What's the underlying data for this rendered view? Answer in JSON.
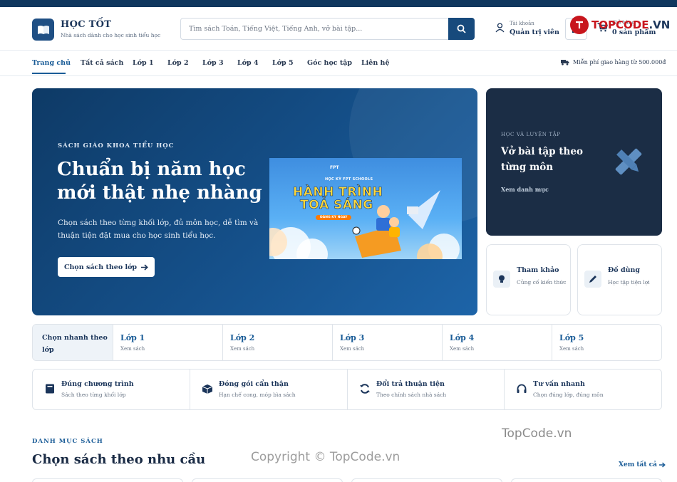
{
  "brand": {
    "name": "HỌC TỐT",
    "tagline": "Nhà sách dành cho học sinh tiểu học"
  },
  "search": {
    "placeholder": "Tìm sách Toán, Tiếng Việt, Tiếng Anh, vở bài tập..."
  },
  "account": {
    "label": "Tài khoản",
    "value": "Quản trị viên"
  },
  "cart": {
    "label": "Giỏ hàng",
    "value": "0 sản phẩm"
  },
  "watermark_logo": {
    "brand": "TOPCODE",
    "suffix": ".VN"
  },
  "nav": {
    "items": [
      {
        "label": "Trang chủ",
        "active": true
      },
      {
        "label": "Tất cả sách"
      },
      {
        "label": "Lớp 1"
      },
      {
        "label": "Lớp 2"
      },
      {
        "label": "Lớp 3"
      },
      {
        "label": "Lớp 4"
      },
      {
        "label": "Lớp 5"
      },
      {
        "label": "Góc học tập"
      },
      {
        "label": "Liên hệ"
      }
    ],
    "shipping": "Miễn phí giao hàng từ 500.000đ"
  },
  "hero": {
    "eyebrow": "SÁCH GIÁO KHOA TIỂU HỌC",
    "title": "Chuẩn bị năm học mới thật nhẹ nhàng",
    "description": "Chọn sách theo từng khối lớp, đủ môn học, dễ tìm và thuận tiện đặt mua cho học sinh tiểu học.",
    "button": "Chọn sách theo lớp",
    "banner": {
      "org": "FPT",
      "school": "HỌC KỲ FPT SCHOOLS",
      "line1": "HÀNH TRÌNH",
      "line2": "TOẢ SÁNG",
      "cta": "ĐĂNG KÝ NGAY"
    }
  },
  "side": {
    "eyebrow": "HỌC VÀ LUYỆN TẬP",
    "title": "Vở bài tập theo từng môn",
    "link": "Xem danh mục",
    "cards": [
      {
        "title": "Tham khảo",
        "subtitle": "Củng cố kiến thức"
      },
      {
        "title": "Đồ dùng",
        "subtitle": "Học tập tiện lợi"
      }
    ]
  },
  "grades": {
    "label": "Chọn nhanh theo lớp",
    "items": [
      {
        "title": "Lớp 1",
        "sub": "Xem sách"
      },
      {
        "title": "Lớp 2",
        "sub": "Xem sách"
      },
      {
        "title": "Lớp 3",
        "sub": "Xem sách"
      },
      {
        "title": "Lớp 4",
        "sub": "Xem sách"
      },
      {
        "title": "Lớp 5",
        "sub": "Xem sách"
      }
    ]
  },
  "features": [
    {
      "title": "Đúng chương trình",
      "sub": "Sách theo từng khối lớp"
    },
    {
      "title": "Đóng gói cẩn thận",
      "sub": "Hạn chế cong, móp bìa sách"
    },
    {
      "title": "Đổi trả thuận tiện",
      "sub": "Theo chính sách nhà sách"
    },
    {
      "title": "Tư vấn nhanh",
      "sub": "Chọn đúng lớp, đúng môn"
    }
  ],
  "category": {
    "eyebrow": "DANH MỤC SÁCH",
    "title": "Chọn sách theo nhu cầu",
    "link": "Xem tất cả"
  },
  "watermarks": {
    "site": "TopCode.vn",
    "copyright": "Copyright © TopCode.vn"
  },
  "colors": {
    "primary": "#174a7c",
    "accent": "#1a5c97",
    "dark_card": "#1b2d45",
    "topbar": "#10375e"
  }
}
